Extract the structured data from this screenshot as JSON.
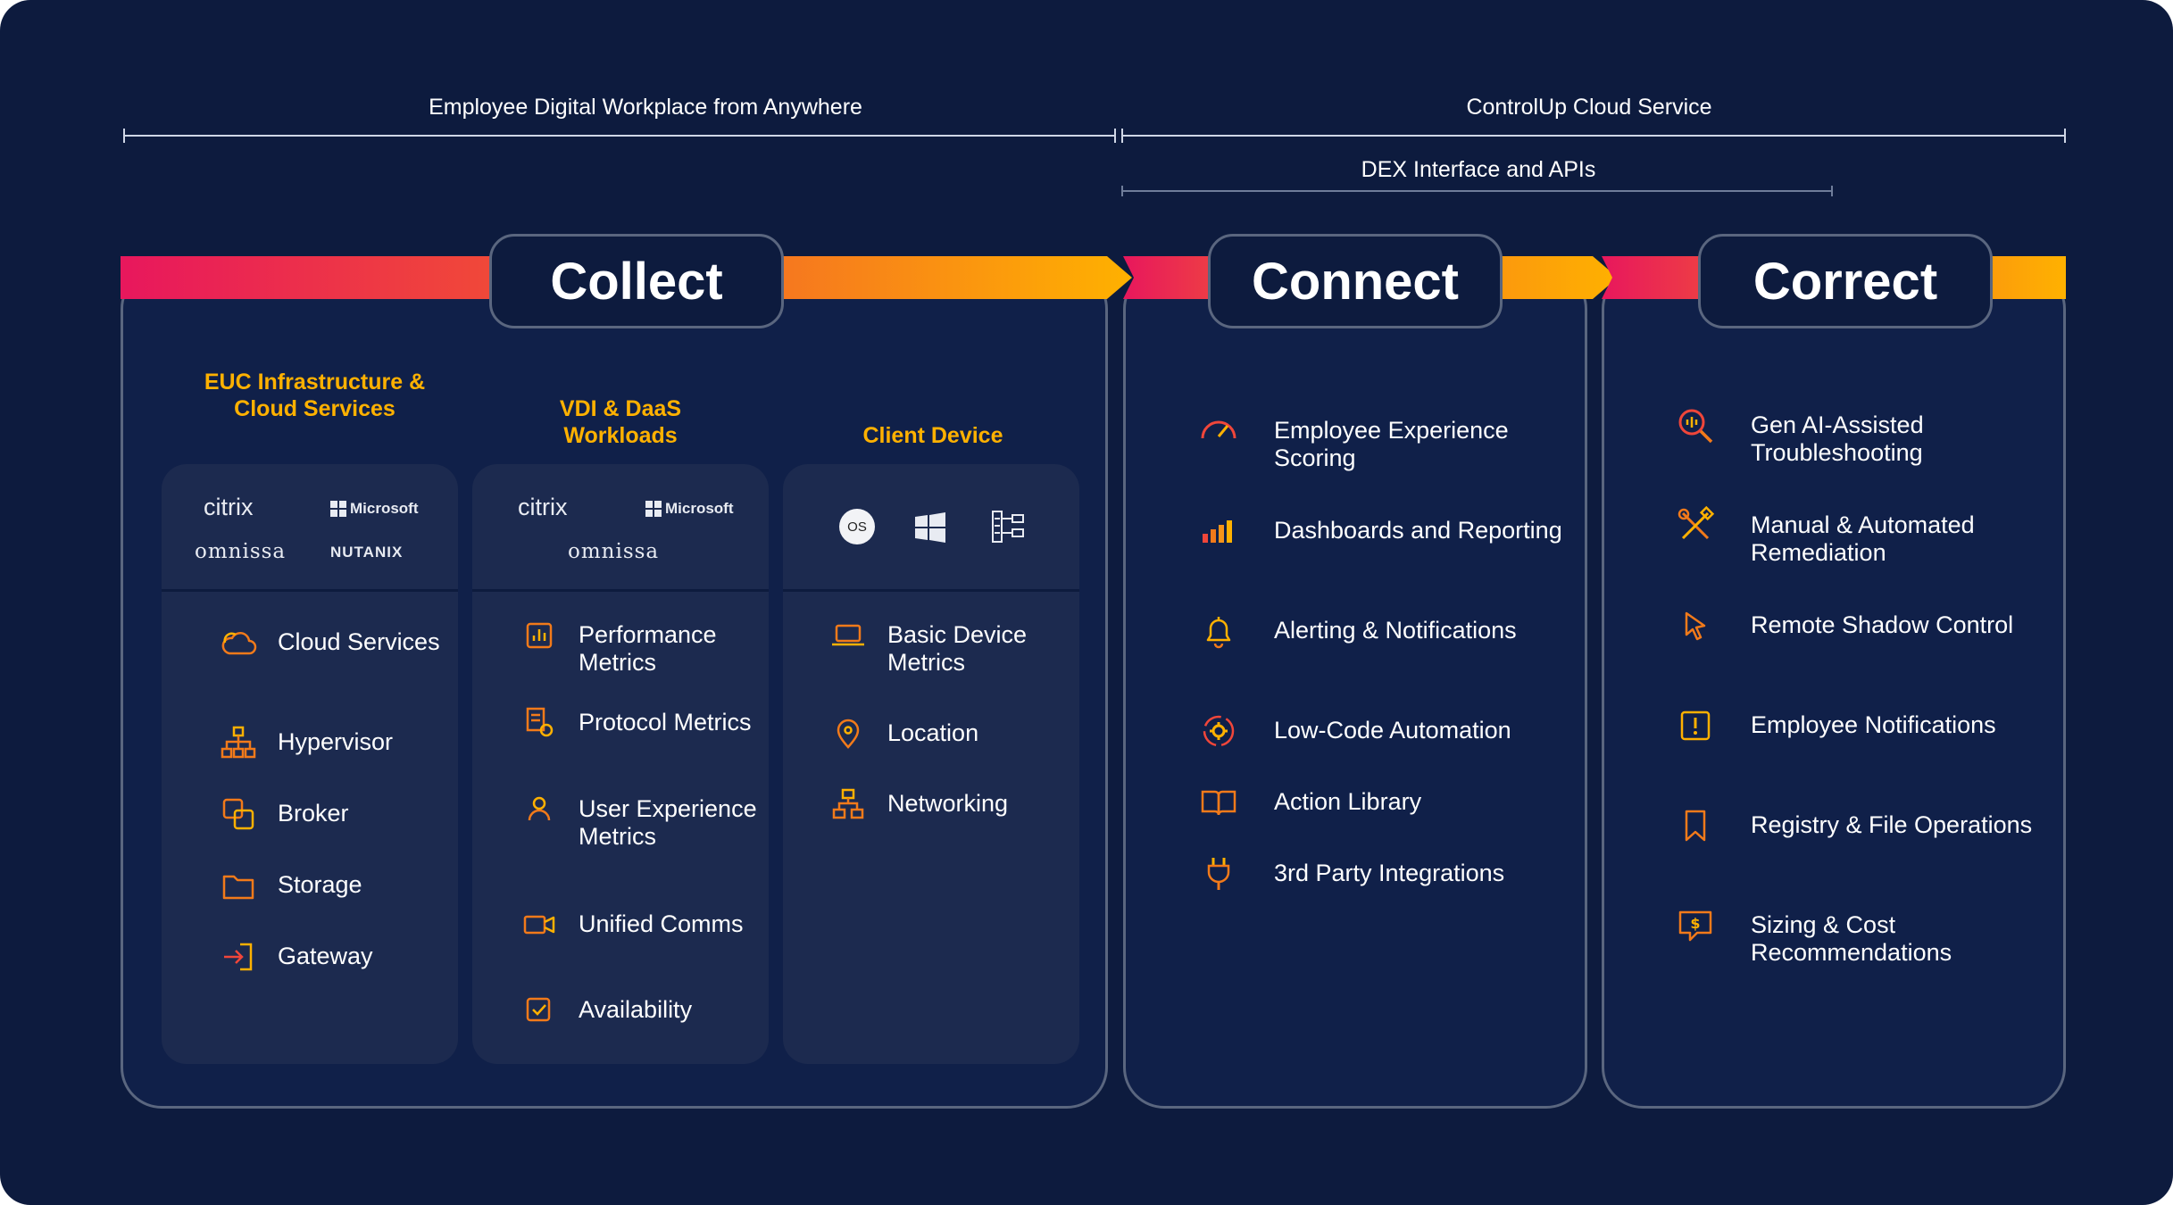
{
  "header": {
    "left_label": "Employee Digital Workplace from Anywhere",
    "right_label": "ControlUp Cloud Service",
    "dex_label": "DEX Interface and APIs"
  },
  "colors": {
    "background": "#0d1b3e",
    "accent_yellow": "#ffb100",
    "accent_orange": "#f27a1a",
    "accent_pink": "#e8175d"
  },
  "stages": {
    "collect": "Collect",
    "connect": "Connect",
    "correct": "Correct"
  },
  "collect": {
    "columns": [
      {
        "title": "EUC Infrastructure & Cloud Services",
        "logos": [
          "citrix",
          "Microsoft",
          "omnissa",
          "NUTANIX"
        ],
        "items": [
          {
            "label": "Cloud Services",
            "icon": "cloud-icon"
          },
          {
            "label": "Hypervisor",
            "icon": "hierarchy-icon"
          },
          {
            "label": "Broker",
            "icon": "broker-icon"
          },
          {
            "label": "Storage",
            "icon": "folder-icon"
          },
          {
            "label": "Gateway",
            "icon": "login-icon"
          }
        ]
      },
      {
        "title": "VDI & DaaS Workloads",
        "logos": [
          "citrix",
          "Microsoft",
          "omnissa"
        ],
        "items": [
          {
            "label": "Performance Metrics",
            "icon": "bar-chart-icon"
          },
          {
            "label": "Protocol Metrics",
            "icon": "document-icon"
          },
          {
            "label": "User Experience Metrics",
            "icon": "user-icon"
          },
          {
            "label": "Unified Comms",
            "icon": "video-icon"
          },
          {
            "label": "Availability",
            "icon": "check-square-icon"
          }
        ]
      },
      {
        "title": "Client Device",
        "logos": [
          "macOS",
          "Windows",
          "Linux"
        ],
        "items": [
          {
            "label": "Basic Device Metrics",
            "icon": "laptop-icon"
          },
          {
            "label": "Location",
            "icon": "map-pin-icon"
          },
          {
            "label": "Networking",
            "icon": "network-icon"
          }
        ]
      }
    ]
  },
  "connect": {
    "items": [
      {
        "label": "Employee Experience Scoring",
        "icon": "gauge-icon"
      },
      {
        "label": "Dashboards and Reporting",
        "icon": "signal-bars-icon"
      },
      {
        "label": "Alerting & Notifications",
        "icon": "bell-icon"
      },
      {
        "label": "Low-Code Automation",
        "icon": "gear-cycle-icon"
      },
      {
        "label": "Action Library",
        "icon": "book-icon"
      },
      {
        "label": "3rd Party Integrations",
        "icon": "plug-icon"
      }
    ]
  },
  "correct": {
    "items": [
      {
        "label": "Gen AI-Assisted Troubleshooting",
        "icon": "search-ai-icon"
      },
      {
        "label": "Manual & Automated Remediation",
        "icon": "tools-icon"
      },
      {
        "label": "Remote Shadow Control",
        "icon": "cursor-icon"
      },
      {
        "label": "Employee Notifications",
        "icon": "alert-box-icon"
      },
      {
        "label": "Registry & File Operations",
        "icon": "bookmark-icon"
      },
      {
        "label": "Sizing & Cost Recommendations",
        "icon": "dollar-chat-icon"
      }
    ]
  },
  "logo_text": {
    "citrix": "citrix",
    "microsoft": "Microsoft",
    "omnissa": "omnissa",
    "nutanix": "NUTANIX",
    "macos": "OS"
  }
}
